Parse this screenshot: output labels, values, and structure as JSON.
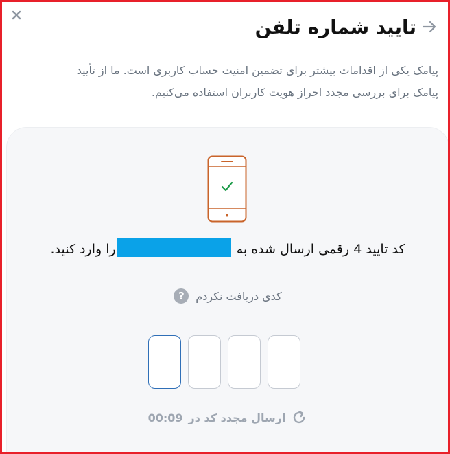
{
  "header": {
    "title": "تایید شماره تلفن"
  },
  "description": {
    "line1": "پیامک یکی از اقدامات بیشتر برای تضمین امنیت حساب کاربری است. ما از تأیید",
    "line2": "پیامک برای بررسی مجدد احراز هویت کاربران استفاده می‌کنیم."
  },
  "verify": {
    "prompt_before": "کد تایید 4 رقمی ارسال شده به",
    "prompt_after": "را وارد کنید.",
    "no_code_label": "کدی دریافت نکردم",
    "otp_count": 4,
    "active_digit": 1,
    "resend_label": "ارسال مجدد کد در",
    "resend_timer": "00:09"
  },
  "colors": {
    "phone_accent": "#c9642b",
    "check": "#1e9c4a",
    "phone_mask": "#0aa2e8",
    "frame_border": "#e8202a"
  },
  "icons": {
    "close": "close-icon",
    "back": "arrow-right-icon",
    "phone": "phone-check-icon",
    "help": "question-circle-icon",
    "refresh": "refresh-icon"
  }
}
